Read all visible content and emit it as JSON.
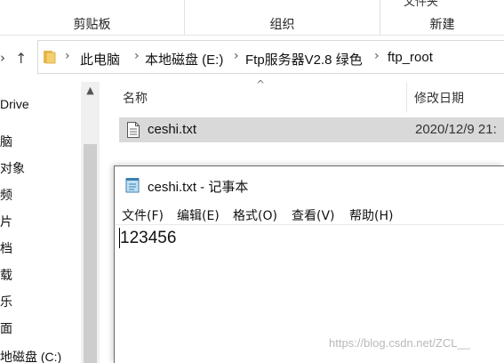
{
  "ribbon": {
    "groups": [
      {
        "label": "剪贴板"
      },
      {
        "label": "组织"
      },
      {
        "label": "新建",
        "top_cut": "文件夹"
      }
    ]
  },
  "nav": {
    "chevron": "›",
    "up_arrow": "↑"
  },
  "address": {
    "crumbs": [
      "此电脑",
      "本地磁盘 (E:)",
      "Ftp服务器V2.8 绿色",
      "ftp_root"
    ],
    "separator": "›"
  },
  "left_pane": {
    "items": [
      "Drive",
      "脑",
      "对象",
      "频",
      "片",
      "档",
      "载",
      "乐",
      "面",
      "地磁盘 (C:)"
    ]
  },
  "columns": {
    "name": "名称",
    "date": "修改日期",
    "sort_caret": "^"
  },
  "files": [
    {
      "name": "ceshi.txt",
      "date": "2020/12/9 21:"
    }
  ],
  "notepad": {
    "title": "ceshi.txt - 记事本",
    "menu": [
      "文件(F)",
      "编辑(E)",
      "格式(O)",
      "查看(V)",
      "帮助(H)"
    ],
    "content": "123456"
  },
  "watermark": "https://blog.csdn.net/ZCL__",
  "icons": {
    "folder": "folder-icon",
    "file": "text-file-icon",
    "notepad": "notepad-icon"
  },
  "colors": {
    "selected_row": "#d9d9d9",
    "folder_yellow": "#e8b64a",
    "scroll_track": "#f0f0f0"
  }
}
